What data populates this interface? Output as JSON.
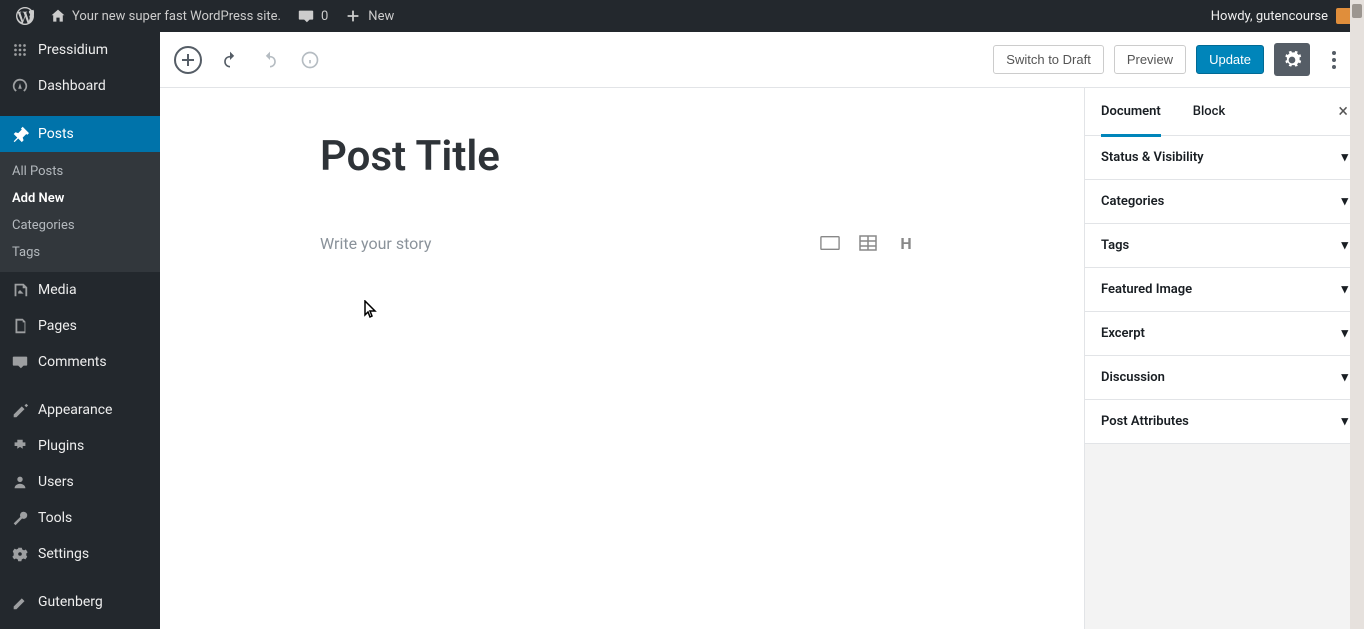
{
  "adminbar": {
    "site_name": "Your new super fast WordPress site.",
    "comments_count": "0",
    "new_label": "New",
    "howdy_prefix": "Howdy, ",
    "username": "gutencourse"
  },
  "sidebar": {
    "items": [
      {
        "label": "Pressidium"
      },
      {
        "label": "Dashboard"
      },
      {
        "label": "Posts"
      },
      {
        "label": "Media"
      },
      {
        "label": "Pages"
      },
      {
        "label": "Comments"
      },
      {
        "label": "Appearance"
      },
      {
        "label": "Plugins"
      },
      {
        "label": "Users"
      },
      {
        "label": "Tools"
      },
      {
        "label": "Settings"
      },
      {
        "label": "Gutenberg"
      }
    ],
    "posts_submenu": [
      {
        "label": "All Posts"
      },
      {
        "label": "Add New"
      },
      {
        "label": "Categories"
      },
      {
        "label": "Tags"
      }
    ]
  },
  "editor_header": {
    "switch_to_draft": "Switch to Draft",
    "preview": "Preview",
    "update": "Update"
  },
  "editor": {
    "title_value": "Post Title",
    "body_placeholder": "Write your story"
  },
  "panel": {
    "tabs": {
      "document": "Document",
      "block": "Block"
    },
    "sections": [
      {
        "label": "Status & Visibility"
      },
      {
        "label": "Categories"
      },
      {
        "label": "Tags"
      },
      {
        "label": "Featured Image"
      },
      {
        "label": "Excerpt"
      },
      {
        "label": "Discussion"
      },
      {
        "label": "Post Attributes"
      }
    ]
  }
}
